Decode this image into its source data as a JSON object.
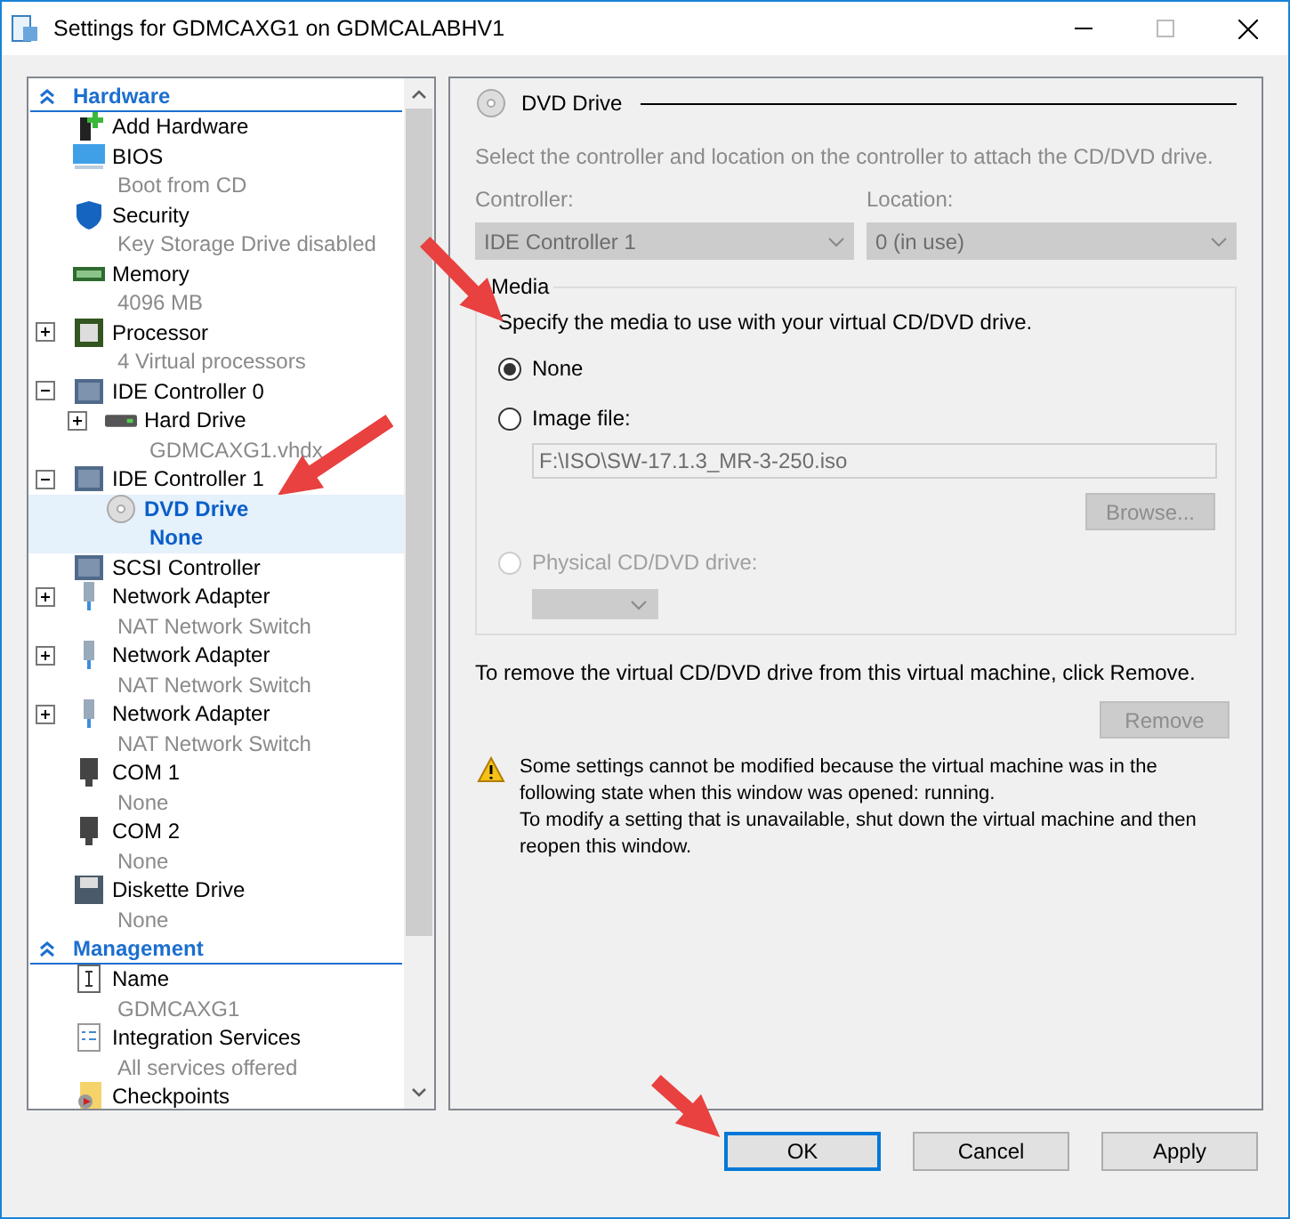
{
  "window": {
    "title": "Settings for GDMCAXG1 on GDMCALABHV1"
  },
  "sidebar": {
    "sections": [
      {
        "title": "Hardware",
        "expanded": true,
        "items": [
          {
            "kind": "add",
            "label": "Add Hardware",
            "selected": false
          },
          {
            "kind": "bios",
            "label": "BIOS",
            "detail": "Boot from CD",
            "selected": false
          },
          {
            "kind": "security",
            "label": "Security",
            "detail": "Key Storage Drive disabled",
            "selected": false
          },
          {
            "kind": "memory",
            "label": "Memory",
            "detail": "4096 MB",
            "selected": false
          },
          {
            "kind": "processor",
            "label": "Processor",
            "detail": "4 Virtual processors",
            "expanded": false,
            "selected": false
          },
          {
            "kind": "controller",
            "label": "IDE Controller 0",
            "expanded": true,
            "selected": false,
            "children": [
              {
                "kind": "disk",
                "label": "Hard Drive",
                "detail": "GDMCAXG1.vhdx",
                "expanded": false,
                "selected": false
              }
            ]
          },
          {
            "kind": "controller",
            "label": "IDE Controller 1",
            "expanded": true,
            "selected": false,
            "children": [
              {
                "kind": "dvd",
                "label": "DVD Drive",
                "detail": "None",
                "selected": true
              }
            ]
          },
          {
            "kind": "scsi",
            "label": "SCSI Controller",
            "selected": false
          },
          {
            "kind": "network",
            "label": "Network Adapter",
            "detail": "NAT Network Switch",
            "expanded": false,
            "selected": false
          },
          {
            "kind": "network",
            "label": "Network Adapter",
            "detail": "NAT Network Switch",
            "expanded": false,
            "selected": false
          },
          {
            "kind": "network",
            "label": "Network Adapter",
            "detail": "NAT Network Switch",
            "expanded": false,
            "selected": false
          },
          {
            "kind": "com",
            "label": "COM 1",
            "detail": "None",
            "selected": false
          },
          {
            "kind": "com",
            "label": "COM 2",
            "detail": "None",
            "selected": false
          },
          {
            "kind": "diskette",
            "label": "Diskette Drive",
            "detail": "None",
            "selected": false
          }
        ]
      },
      {
        "title": "Management",
        "expanded": true,
        "items": [
          {
            "kind": "name",
            "label": "Name",
            "detail": "GDMCAXG1",
            "selected": false
          },
          {
            "kind": "integration",
            "label": "Integration Services",
            "detail": "All services offered",
            "selected": false
          },
          {
            "kind": "checkpoint",
            "label": "Checkpoints",
            "selected": false
          }
        ]
      }
    ]
  },
  "panel": {
    "title": "DVD Drive",
    "intro": "Select the controller and location on the controller to attach the CD/DVD drive.",
    "controller": {
      "label": "Controller:",
      "value": "IDE Controller 1",
      "disabled": true
    },
    "location": {
      "label": "Location:",
      "value": "0 (in use)",
      "disabled": true
    },
    "media": {
      "title": "Media",
      "hint": "Specify the media to use with your virtual CD/DVD drive.",
      "options": [
        {
          "label": "None",
          "selected": true,
          "disabled": false
        },
        {
          "label": "Image file:",
          "selected": false,
          "disabled": false
        },
        {
          "label": "Physical CD/DVD drive:",
          "selected": false,
          "disabled": true
        }
      ],
      "image_path": "F:\\ISO\\SW-17.1.3_MR-3-250.iso",
      "browse": "Browse..."
    },
    "remove_hint": "To remove the virtual CD/DVD drive from this virtual machine, click Remove.",
    "remove": "Remove",
    "warning": [
      "Some settings cannot be modified because the virtual machine was in the following state when this window was opened: running.",
      "To modify a setting that is unavailable, shut down the virtual machine and then reopen this window."
    ]
  },
  "buttons": [
    {
      "label": "OK",
      "selected": true
    },
    {
      "label": "Cancel",
      "selected": false
    },
    {
      "label": "Apply",
      "selected": false
    }
  ]
}
